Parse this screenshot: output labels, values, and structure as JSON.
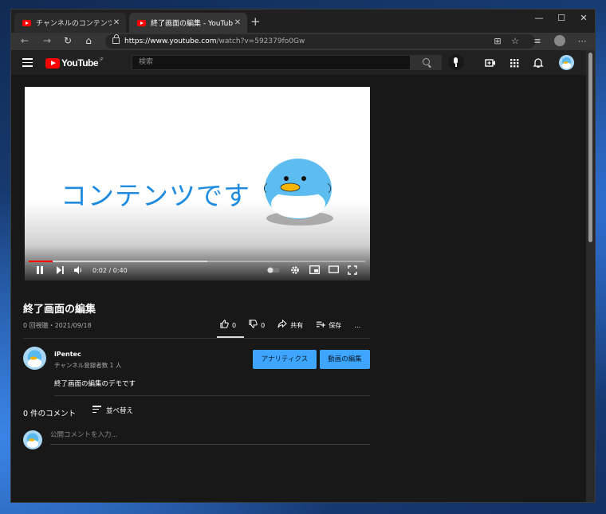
{
  "browser": {
    "tabs": [
      {
        "title": "チャンネルのコンテンツ - YouTube Studio",
        "active": false
      },
      {
        "title": "終了画面の編集 - YouTube",
        "active": true
      }
    ],
    "new_tab": "+",
    "url_host": "https://www.youtube.com",
    "url_path": "/watch?v=592379fo0Gw",
    "window_controls": {
      "minimize": "—",
      "maximize": "☐",
      "close": "✕"
    }
  },
  "youtube": {
    "logo_text": "YouTube",
    "region": "JP",
    "search_placeholder": "検索"
  },
  "player": {
    "overlay_text": "コンテンツです",
    "time": "0:02 / 0:40",
    "progress_fraction": 0.07,
    "buffered_fraction": 0.53
  },
  "video": {
    "title": "終了画面の編集",
    "meta": "0 回視聴・2021/09/18",
    "likes": "0",
    "dislikes": "0",
    "share_label": "共有",
    "save_label": "保存",
    "more": "…"
  },
  "channel": {
    "name": "iPentec",
    "subscribers": "チャンネル登録者数 1 人",
    "analytics_button": "アナリティクス",
    "edit_button": "動画の編集",
    "description": "終了画面の編集のデモです"
  },
  "comments": {
    "count_label": "0 件のコメント",
    "sort_label": "並べ替え",
    "input_placeholder": "公開コメントを入力..."
  },
  "colors": {
    "accent_blue": "#3ea6ff",
    "youtube_red": "#ff0000",
    "video_text_blue": "#1e8be0"
  }
}
